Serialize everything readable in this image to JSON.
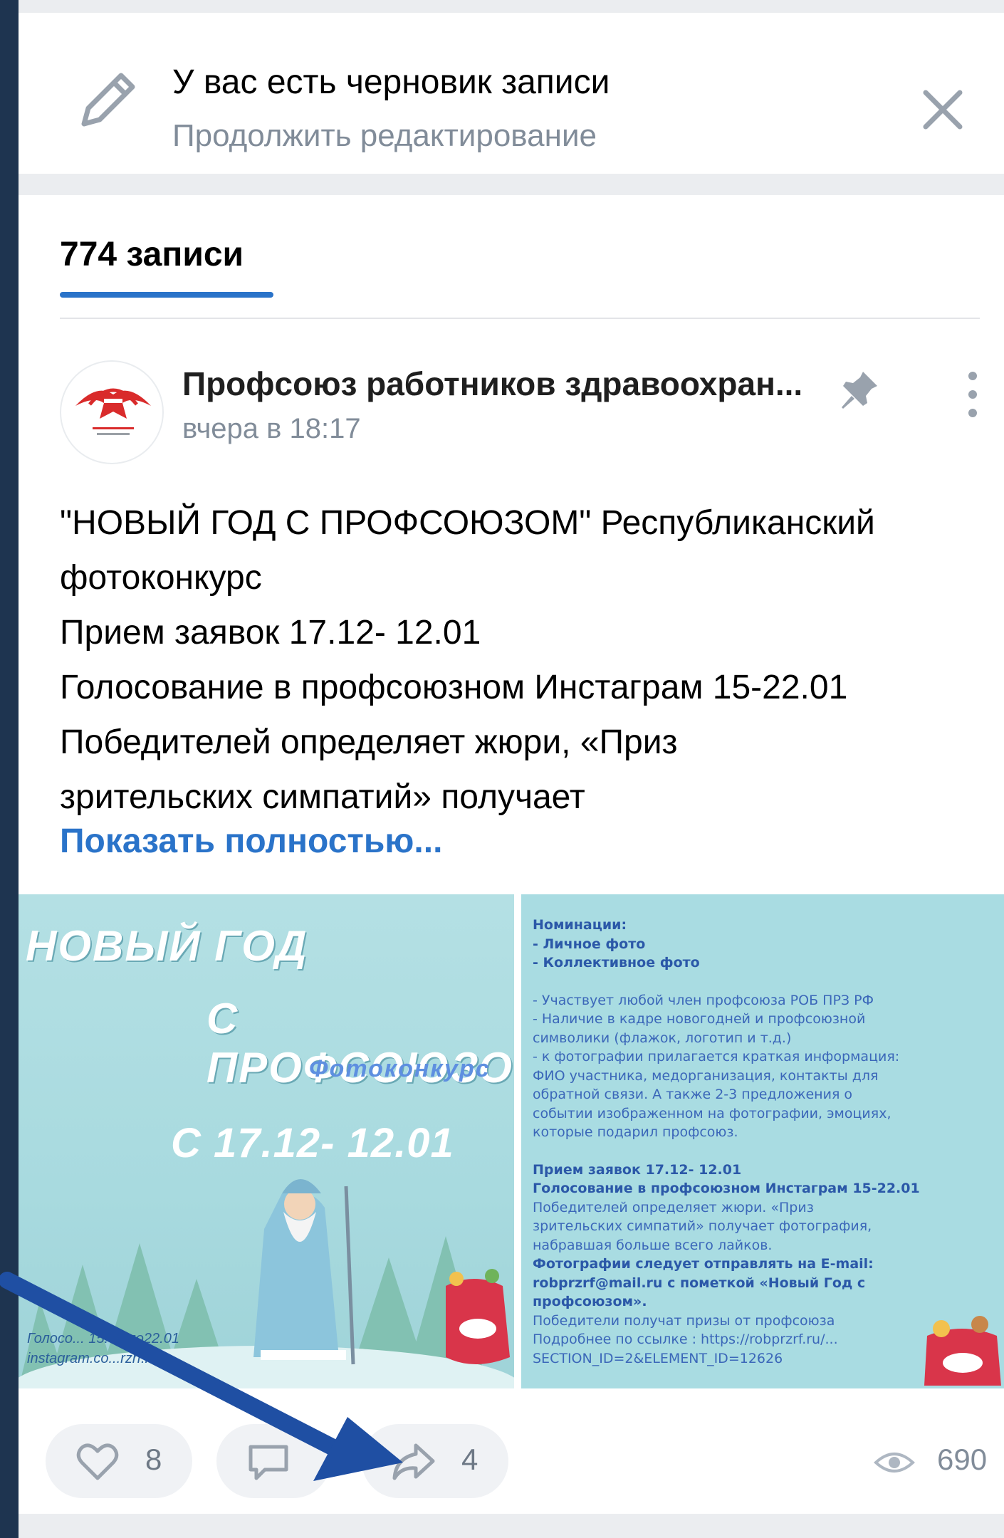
{
  "draft": {
    "title": "У вас есть черновик записи",
    "subtitle": "Продолжить редактирование",
    "icons": [
      "pencil-icon",
      "close-icon"
    ]
  },
  "wall": {
    "tab_label": "774 записи"
  },
  "post": {
    "author": "Профсоюз работников здравоохран...",
    "time": "вчера в 18:17",
    "text_lines": [
      "\"НОВЫЙ ГОД С ПРОФСОЮЗОМ\" Республиканский",
      "фотоконкурс",
      "Прием заявок 17.12- 12.01",
      "Голосование в профсоюзном Инстаграм 15-22.01",
      "Победителей определяет жюри, «Приз",
      "зрительских симпатий» получает"
    ],
    "show_more": "Показать полностью...",
    "likes": "8",
    "shares": "4",
    "views": "690"
  },
  "image1": {
    "line1": "НОВЫЙ ГОД",
    "line2": "С ПРОФСОЮЗОМ!",
    "line3": "Фотоконкурс",
    "line4": "С 17.12- 12.01",
    "footer1": "Голосо... 15.01 по22.01",
    "footer2": "instagram.co...rzrf.ru"
  },
  "image2": {
    "lines": [
      "Номинации:",
      "- Личное фото",
      "- Коллективное фото",
      "",
      "- Участвует любой член профсоюза РОБ ПРЗ РФ",
      "- Наличие в кадре новогодней и профсоюзной",
      "символики (флажок, логотип и т.д.)",
      "- к фотографии прилагается краткая информация:",
      "ФИО участника, медорганизация, контакты для",
      "обратной связи. А также 2-3 предложения о",
      "событии изображенном на фотографии, эмоциях,",
      "которые подарил профсоюз.",
      "",
      "Прием заявок 17.12- 12.01",
      "Голосование в профсоюзном Инстаграм 15-22.01",
      "Победителей определяет жюри. «Приз",
      "зрительских симпатий» получает фотография,",
      "набравшая больше всего лайков.",
      "Фотографии следует отправлять на E-mail:",
      "robprzrf@mail.ru с пометкой «Новый Год с",
      "профсоюзом».",
      "Победители получат призы от профсоюза",
      "Подробнее по ссылке : https://robprzrf.ru/...",
      "SECTION_ID=2&ELEMENT_ID=12626"
    ]
  },
  "colors": {
    "accent": "#2a73c9",
    "annotation_arrow": "#1f4fa3",
    "frame": "#1e3450"
  }
}
